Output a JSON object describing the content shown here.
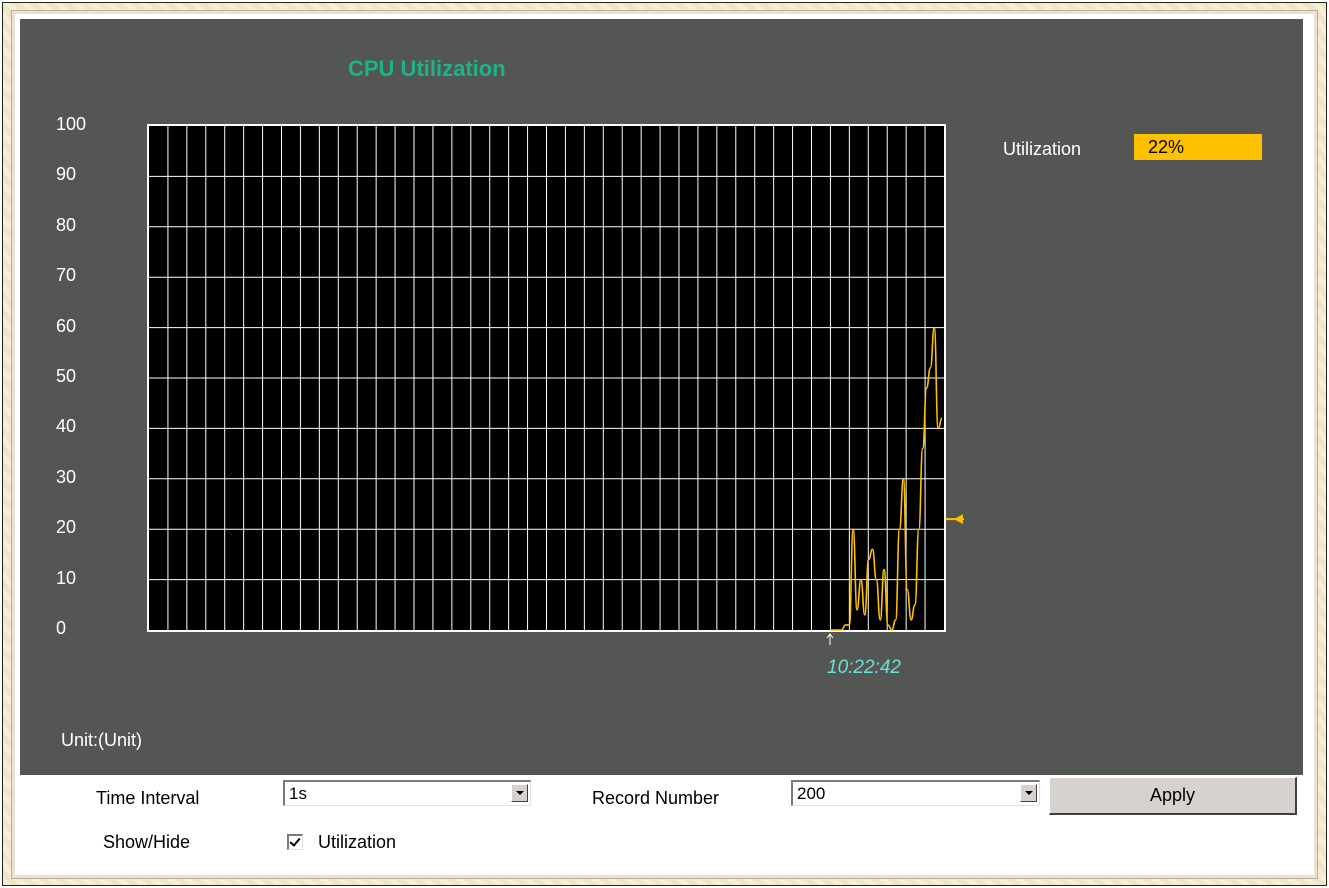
{
  "panel": {
    "title": "CPU Utilization",
    "unit_label": "Unit:(Unit)",
    "utilization_label": "Utilization",
    "utilization_value": "22%",
    "utilization_color": "#ffc000",
    "time_marker_label": "10:22:42",
    "y_ticks": [
      "100",
      "90",
      "80",
      "70",
      "60",
      "50",
      "40",
      "30",
      "20",
      "10",
      "0"
    ]
  },
  "controls": {
    "time_interval_label": "Time Interval",
    "time_interval_value": "1s",
    "record_number_label": "Record Number",
    "record_number_value": "200",
    "apply_label": "Apply",
    "show_hide_label": "Show/Hide",
    "show_utilization_label": "Utilization",
    "show_utilization_checked": true
  },
  "chart_data": {
    "type": "line",
    "ylim": [
      0,
      100
    ],
    "grid": true,
    "series": [
      {
        "name": "Utilization",
        "color": "#ffc000",
        "values": [
          0,
          0,
          0,
          0,
          1,
          1,
          20,
          4,
          10,
          3,
          14,
          16,
          10,
          2,
          12,
          1,
          0,
          2,
          20,
          30,
          8,
          2,
          5,
          20,
          36,
          48,
          52,
          60,
          40,
          42
        ]
      }
    ],
    "current_value": 22
  }
}
